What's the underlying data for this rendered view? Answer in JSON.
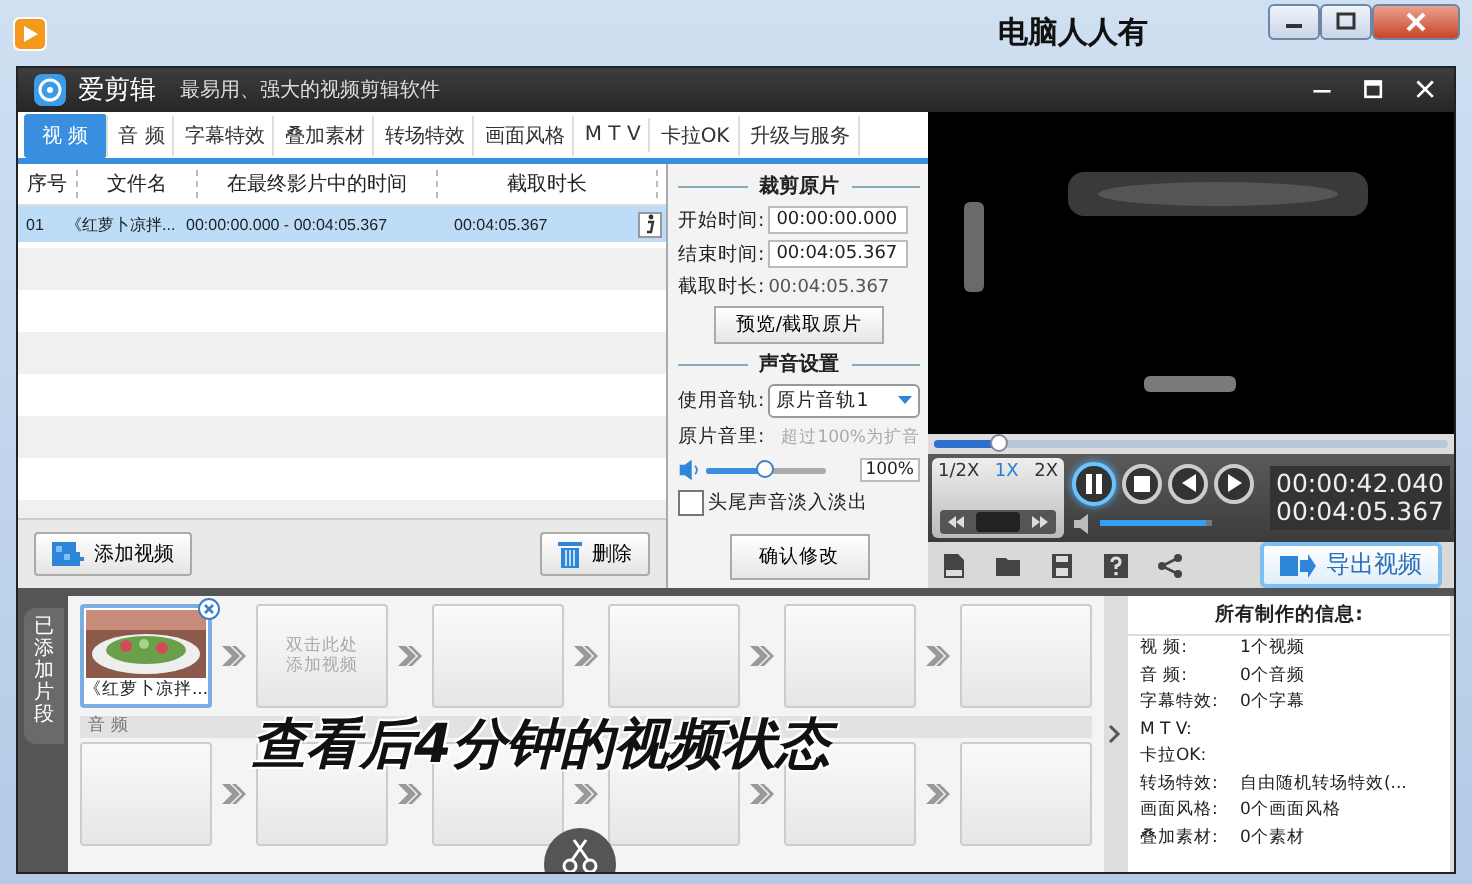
{
  "outer_window": {
    "title_text": "电脑人人有"
  },
  "app": {
    "name": "爱剪辑",
    "tagline": "最易用、强大的视频剪辑软件"
  },
  "tabs": [
    {
      "label": "视 频",
      "selected": true
    },
    {
      "label": "音 频",
      "selected": false
    },
    {
      "label": "字幕特效",
      "selected": false
    },
    {
      "label": "叠加素材",
      "selected": false
    },
    {
      "label": "转场特效",
      "selected": false
    },
    {
      "label": "画面风格",
      "selected": false
    },
    {
      "label": "M T V",
      "selected": false
    },
    {
      "label": "卡拉OK",
      "selected": false
    },
    {
      "label": "升级与服务",
      "selected": false
    }
  ],
  "table": {
    "columns": [
      "序号",
      "文件名",
      "在最终影片中的时间",
      "截取时长"
    ],
    "rows": [
      {
        "index": "01",
        "file": "《红萝卜凉拌...",
        "span": "00:00:00.000 - 00:04:05.367",
        "duration": "00:04:05.367",
        "selected": true
      }
    ]
  },
  "add_video_button": "添加视频",
  "delete_button": "删除",
  "crop": {
    "heading": "裁剪原片",
    "start_label": "开始时间:",
    "start_value": "00:00:00.000",
    "end_label": "结束时间:",
    "end_value": "00:04:05.367",
    "duration_label": "截取时长:",
    "duration_value": "00:04:05.367",
    "preview_button": "预览/截取原片"
  },
  "sound": {
    "heading": "声音设置",
    "track_label": "使用音轨:",
    "track_value": "原片音轨1",
    "volume_label": "原片音里:",
    "volume_hint": "超过100%为扩音",
    "volume": {
      "level": 0.5,
      "reading": "100%"
    },
    "fade": {
      "label": "头尾声音淡入淡出",
      "checked": false
    },
    "confirm_button": "确认修改"
  },
  "player": {
    "progress": {
      "level": 0.13
    },
    "speeds": [
      {
        "label": "1/2X",
        "selected": false
      },
      {
        "label": "1X",
        "selected": true
      },
      {
        "label": "2X",
        "selected": false
      }
    ],
    "playing": true,
    "current_time": "00:00:42.040",
    "total_time": "00:04:05.367",
    "volume": {
      "level": 0.95
    },
    "export_button": "导出视频"
  },
  "clips": {
    "side_tab": "已添加片段",
    "video_slots": [
      {
        "kind": "clip",
        "caption": "《红萝卜凉拌..."
      },
      {
        "kind": "add",
        "hint": "双击此处添加视频"
      },
      {
        "kind": "empty"
      },
      {
        "kind": "empty"
      },
      {
        "kind": "empty"
      },
      {
        "kind": "empty"
      }
    ],
    "audio_label": "音 频",
    "audio_slots": [
      {
        "kind": "empty"
      },
      {
        "kind": "empty"
      },
      {
        "kind": "empty"
      },
      {
        "kind": "empty"
      },
      {
        "kind": "empty"
      },
      {
        "kind": "empty"
      }
    ]
  },
  "caption": "查看后4分钟的视频状态",
  "info": {
    "title": "所有制作的信息:",
    "rows": [
      {
        "label": "视 频:",
        "value": "1个视频"
      },
      {
        "label": "音 频:",
        "value": "0个音频"
      },
      {
        "label": "字幕特效:",
        "value": "0个字幕"
      },
      {
        "label": "M T V:"
      },
      {
        "label": "卡拉OK:"
      },
      {
        "label": "转场特效:",
        "value": "自由随机转场特效(..."
      },
      {
        "label": "画面风格:",
        "value": "0个画面风格"
      },
      {
        "label": "叠加素材:",
        "value": "0个素材"
      }
    ]
  }
}
